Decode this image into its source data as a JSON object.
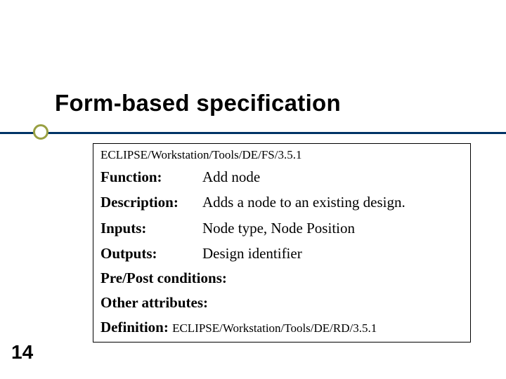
{
  "title": "Form-based specification",
  "page_number": "14",
  "form": {
    "header": "ECLIPSE/Workstation/Tools/DE/FS/3.5.1",
    "rows": [
      {
        "label": "Function:",
        "value": "Add node"
      },
      {
        "label": "Description:",
        "value": "Adds a node to an existing design."
      },
      {
        "label": "Inputs:",
        "value": "Node type, Node Position"
      },
      {
        "label": "Outputs:",
        "value": "Design identifier"
      }
    ],
    "pre_post": "Pre/Post conditions:",
    "other_attrs": "Other attributes:",
    "definition_label": "Definition: ",
    "definition_value": "ECLIPSE/Workstation/Tools/DE/RD/3.5.1"
  }
}
